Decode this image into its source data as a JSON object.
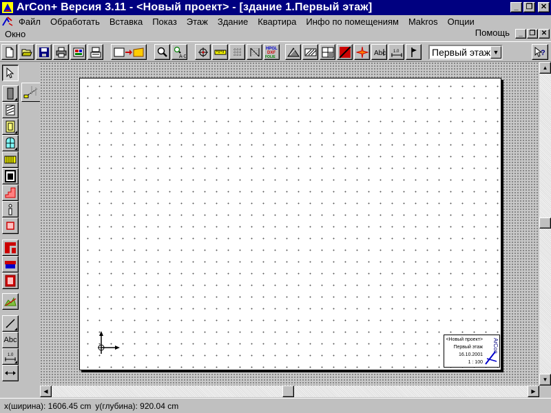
{
  "window": {
    "title": "ArCon+  Версия 3.11 - <Новый проект> - [здание 1.Первый этаж]",
    "minimize": "_",
    "restore": "❐",
    "close": "✕"
  },
  "menu": {
    "row1": [
      {
        "id": "file",
        "label": "Файл"
      },
      {
        "id": "process",
        "label": "Обработать"
      },
      {
        "id": "insert",
        "label": "Вставка"
      },
      {
        "id": "view",
        "label": "Показ"
      },
      {
        "id": "floor",
        "label": "Этаж"
      },
      {
        "id": "building",
        "label": "Здание"
      },
      {
        "id": "apartment",
        "label": "Квартира"
      },
      {
        "id": "room-info",
        "label": "Инфо по помещениям"
      },
      {
        "id": "makros",
        "label": "Makros"
      },
      {
        "id": "options",
        "label": "Опции"
      }
    ],
    "row2": [
      {
        "id": "window",
        "label": "Окно"
      }
    ],
    "help": "Помощь"
  },
  "toolbar": {
    "floor_select": "Первый этаж",
    "dropdown_arrow": "▼",
    "export_label": [
      "HPGL",
      "DXF",
      "FOLIE"
    ]
  },
  "left_toolbar": {
    "text_label": "Abc",
    "dim_label": "1.0"
  },
  "stamp": {
    "project": "<Новый проект>",
    "floor": "Первый этаж",
    "date": "16.10.2001",
    "scale": "1 : 100"
  },
  "statusbar": {
    "x_label": "x(ширина): 1606.45 cm",
    "y_label": "y(глубина): 920.04 cm"
  },
  "colors": {
    "titlebar": "#000080",
    "face": "#c0c0c0",
    "accent_red": "#cc0000"
  }
}
